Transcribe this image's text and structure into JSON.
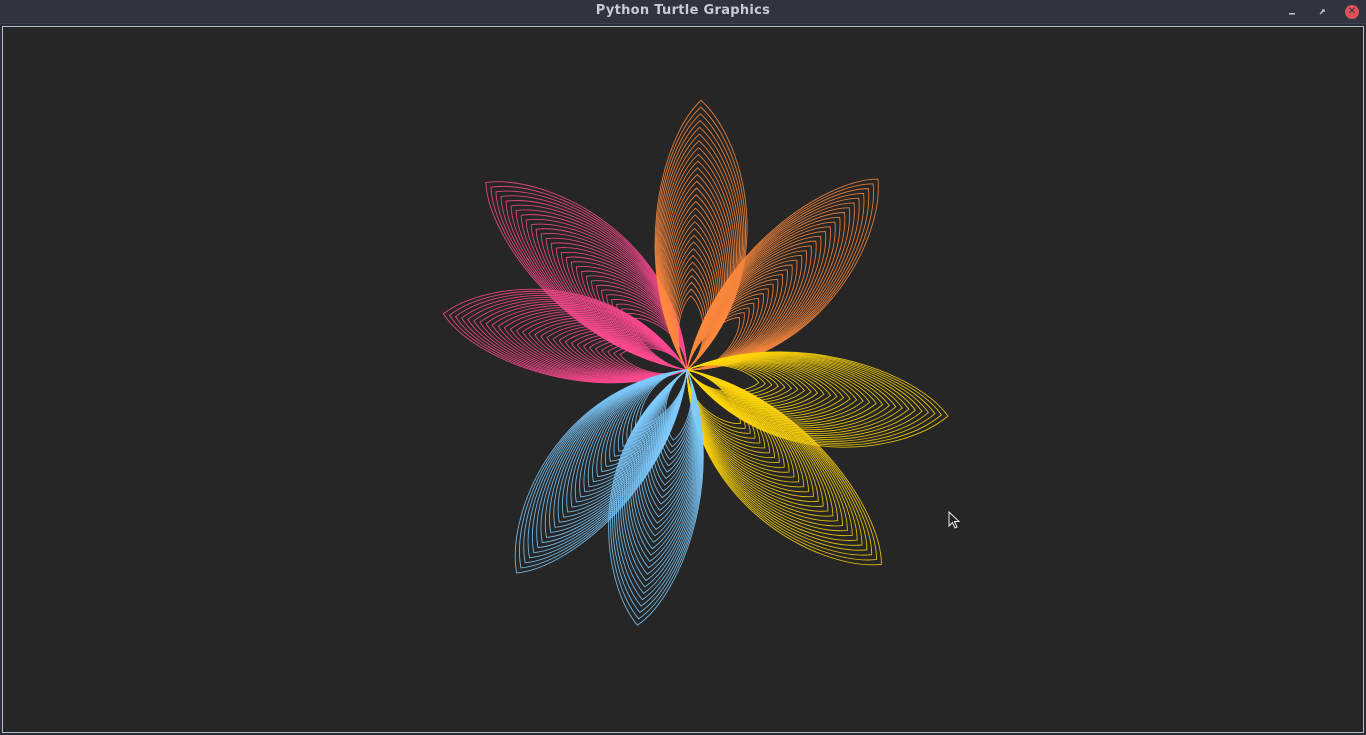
{
  "window": {
    "title": "Python Turtle Graphics",
    "controls": {
      "minimize_icon": "minimize-icon",
      "maximize_icon": "maximize-icon",
      "close_icon": "close-icon"
    }
  },
  "canvas": {
    "background": "#262626",
    "drawing": "flower",
    "petal_count": 8,
    "petal_colors": [
      "#ff4a91",
      "#ff4a91",
      "#ff8a3d",
      "#ff8a3d",
      "#ffd60a",
      "#ffd60a",
      "#7ecbff",
      "#7ecbff"
    ]
  },
  "colors": {
    "pink": "#ff4a91",
    "orange": "#ff8a3d",
    "yellow": "#ffd60a",
    "blue": "#7ecbff",
    "titlebar": "#2f3440",
    "close": "#e2505c"
  }
}
